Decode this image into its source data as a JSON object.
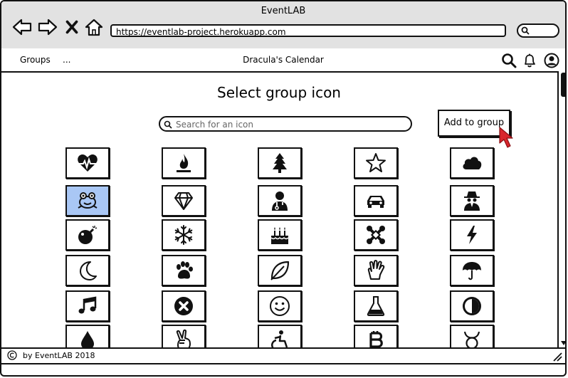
{
  "window": {
    "title": "EventLAB"
  },
  "browser": {
    "url": "https://eventlab-project.herokuapp.com"
  },
  "menubar": {
    "groups": "Groups",
    "more": "...",
    "title": "Dracula's Calendar"
  },
  "page": {
    "heading": "Select group icon",
    "search_placeholder": "Search for an icon",
    "add_button": "Add to group"
  },
  "icons": [
    [
      "heartbeat-icon",
      "fire-icon",
      "tree-icon",
      "star-icon",
      "cloud-icon"
    ],
    [
      "frog-icon",
      "diamond-icon",
      "doctor-icon",
      "car-icon",
      "spy-icon"
    ],
    [
      "bomb-icon",
      "snowflake-icon",
      "birthday-cake-icon",
      "joomla-icon",
      "lightning-icon"
    ],
    [
      "moon-icon",
      "paw-icon",
      "leaf-icon",
      "vulcan-salute-icon",
      "umbrella-icon"
    ],
    [
      "music-icon",
      "close-circle-icon",
      "smiley-icon",
      "flask-icon",
      "contrast-icon"
    ],
    [
      "drop-icon",
      "victory-hand-icon",
      "wheelchair-icon",
      "bitcoin-icon",
      "taurus-icon"
    ]
  ],
  "selected_icon": "frog-icon",
  "footer": {
    "text": "by EventLAB 2018"
  },
  "colors": {
    "selected_tile": "#a9c7f5",
    "cursor": "#d9262c",
    "chrome": "#e2e2e2"
  }
}
